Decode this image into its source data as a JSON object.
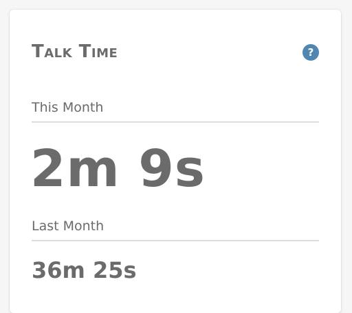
{
  "card": {
    "title": "Talk Time",
    "help_icon_glyph": "?",
    "help_icon": "question-circle-icon",
    "accent_color": "#4f86b2"
  },
  "this_month": {
    "label": "This Month",
    "value": "2m 9s"
  },
  "last_month": {
    "label": "Last Month",
    "value": "36m 25s"
  }
}
